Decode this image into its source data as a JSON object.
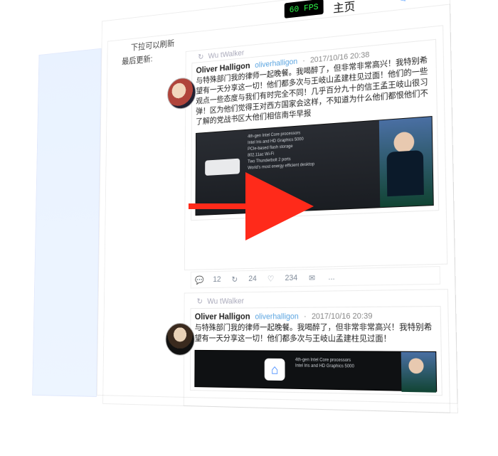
{
  "topbar": {
    "fps": "60 FPS",
    "title": "主页",
    "compose_icon": "✎"
  },
  "pull_refresh": "下拉可以刷新",
  "last_update_label": "最后更新:",
  "retweet": {
    "icon": "↻",
    "by": "Wu tWalker"
  },
  "post1": {
    "name": "Oliver Halligon",
    "handle": "oliverhalligon",
    "time": "2017/10/16 20:38",
    "body": "与特殊部门我的律师一起晚餐。我喝醉了，但非常非常高兴！我特别希望有一天分享这一切！他们都多次与王岐山孟建柱见过面！他们的一些观点一些态度与我们有时完全不同！几乎百分九十的信王孟王岐山很习弹！区为他们觉得王对西方国家会这样，不知道为什么他们都恨他们不了解的党战书区大他们相信南华早报",
    "slide_bullets": "4th-gen Intel Core processors\nIntel Iris and HD Graphics 5000\nPCIe-based flash storage\n802.11ac Wi-Fi\nTwo Thunderbolt 2 ports\nWorld's most energy efficient desktop",
    "actions": {
      "reply": "12",
      "retweet": "24",
      "like": "234",
      "more": "..."
    }
  },
  "post2": {
    "name": "Oliver Halligon",
    "handle": "oliverhalligon",
    "time": "2017/10/16 20:39",
    "body": "与特殊部门我的律师一起晚餐。我喝醉了，但非常非常高兴！我特别希望有一天分享这一切！他们都多次与王岐山孟建柱见过面！",
    "overlay_text": "4th-gen Intel Core processors\nIntel Iris and HD Graphics 5000"
  }
}
